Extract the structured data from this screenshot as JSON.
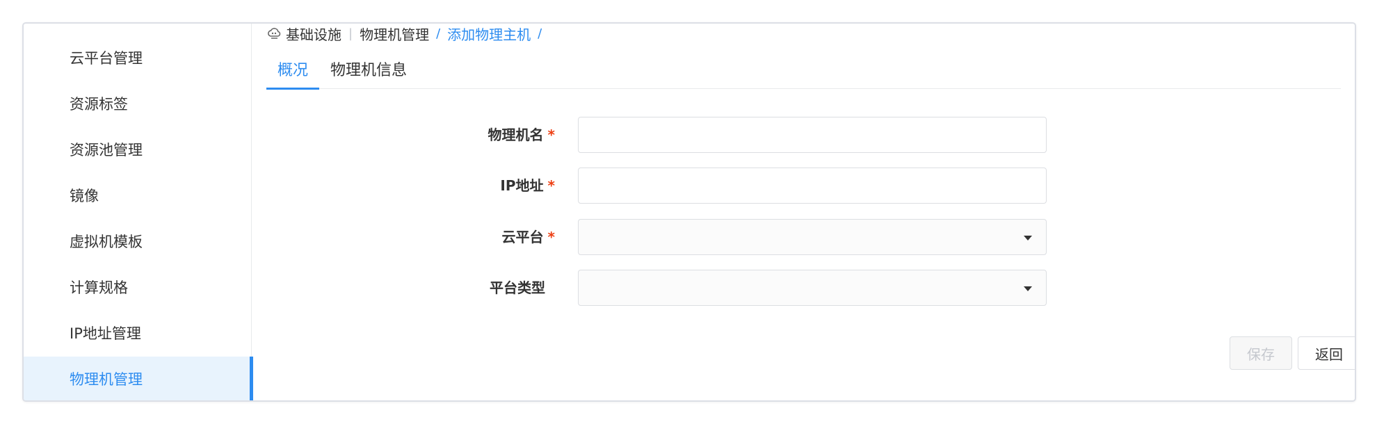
{
  "sidebar": {
    "items": [
      {
        "label": "云平台管理"
      },
      {
        "label": "资源标签"
      },
      {
        "label": "资源池管理"
      },
      {
        "label": "镜像"
      },
      {
        "label": "虚拟机模板"
      },
      {
        "label": "计算规格"
      },
      {
        "label": "IP地址管理"
      },
      {
        "label": "物理机管理",
        "active": true
      }
    ]
  },
  "breadcrumb": {
    "icon": "cloud-icon",
    "items": [
      "基础设施",
      "物理机管理",
      "添加物理主机"
    ],
    "separator": "|",
    "trailing_separator": "/"
  },
  "tabs": [
    {
      "label": "概况",
      "active": true
    },
    {
      "label": "物理机信息"
    }
  ],
  "form": {
    "fields": [
      {
        "label": "物理机名",
        "required": true,
        "type": "text",
        "value": ""
      },
      {
        "label": "IP地址",
        "required": true,
        "type": "text",
        "value": ""
      },
      {
        "label": "云平台",
        "required": true,
        "type": "select",
        "value": ""
      },
      {
        "label": "平台类型",
        "required": false,
        "type": "select",
        "value": ""
      }
    ],
    "required_mark": "*"
  },
  "actions": {
    "save_label": "保存",
    "back_label": "返回"
  },
  "colors": {
    "accent": "#2d8cf0",
    "active_bg": "#e8f3fd",
    "required": "#ed4014",
    "border": "#dcdee2"
  }
}
